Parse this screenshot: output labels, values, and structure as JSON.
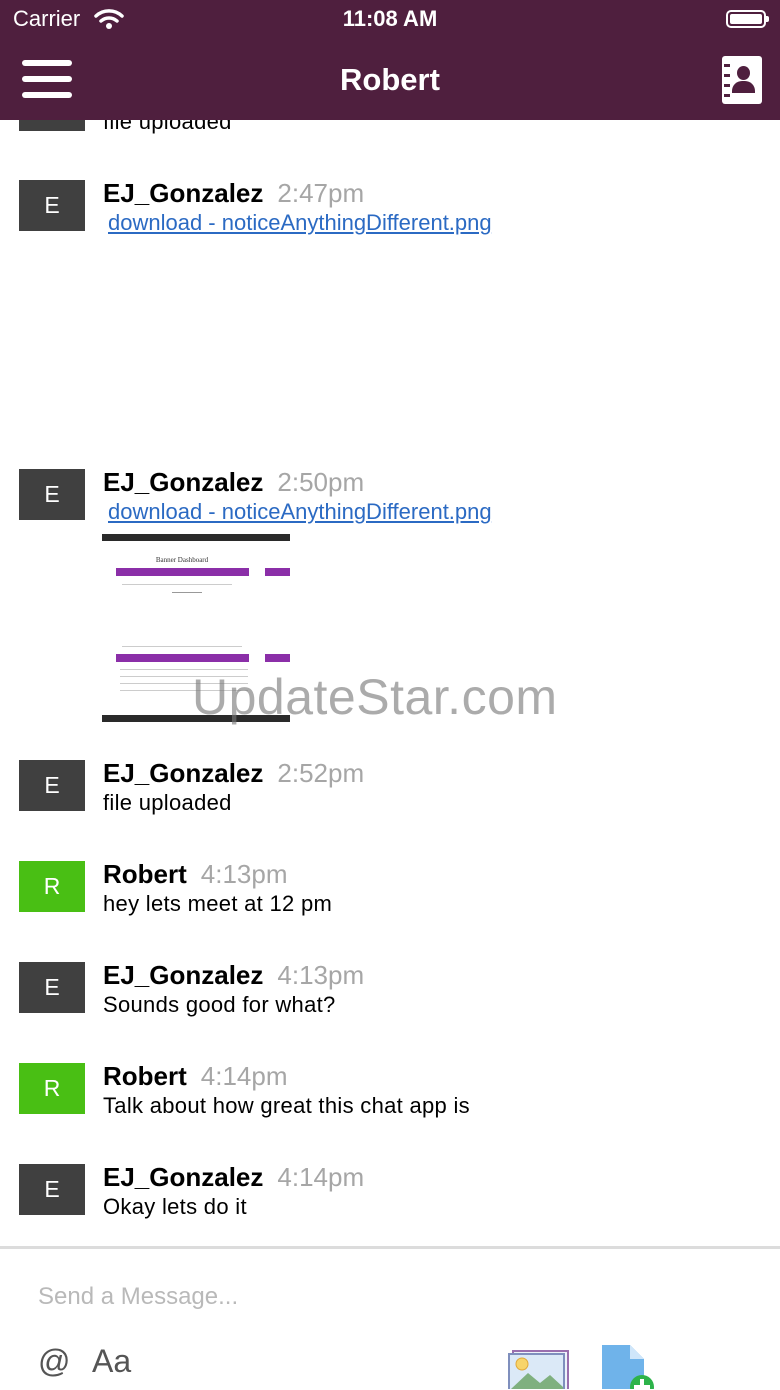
{
  "status_bar": {
    "carrier": "Carrier",
    "time": "11:08 AM"
  },
  "header": {
    "title": "Robert"
  },
  "messages": [
    {
      "initial": "E",
      "author": "",
      "time": "",
      "text": "file uploaded"
    },
    {
      "initial": "E",
      "author": "EJ_Gonzalez",
      "time": "2:47pm",
      "link": "download - noticeAnythingDifferent.png"
    },
    {
      "initial": "E",
      "author": "EJ_Gonzalez",
      "time": "2:50pm",
      "link": "download - noticeAnythingDifferent.png",
      "thumbnail_title": "Banner Dashboard"
    },
    {
      "initial": "E",
      "author": "EJ_Gonzalez",
      "time": "2:52pm",
      "text": "file uploaded"
    },
    {
      "initial": "R",
      "author": "Robert",
      "time": "4:13pm",
      "text": "hey lets meet at 12 pm"
    },
    {
      "initial": "E",
      "author": "EJ_Gonzalez",
      "time": "4:13pm",
      "text": "Sounds good for what?"
    },
    {
      "initial": "R",
      "author": "Robert",
      "time": "4:14pm",
      "text": "Talk about how great this chat app is"
    },
    {
      "initial": "E",
      "author": "EJ_Gonzalez",
      "time": "4:14pm",
      "text": "Okay lets do it"
    }
  ],
  "watermark": "UpdateStar.com",
  "composer": {
    "placeholder": "Send a Message...",
    "mention_label": "@",
    "format_label": "Aa"
  },
  "colors": {
    "header": "#4f1f3e",
    "avatar_e": "#404040",
    "avatar_r": "#49bf14",
    "link": "#2b6ac3"
  },
  "icons": {
    "menu": "hamburger-icon",
    "contacts": "contact-book-icon",
    "wifi": "wifi-icon",
    "battery": "battery-icon",
    "image": "image-picker-icon",
    "file": "file-add-icon"
  }
}
